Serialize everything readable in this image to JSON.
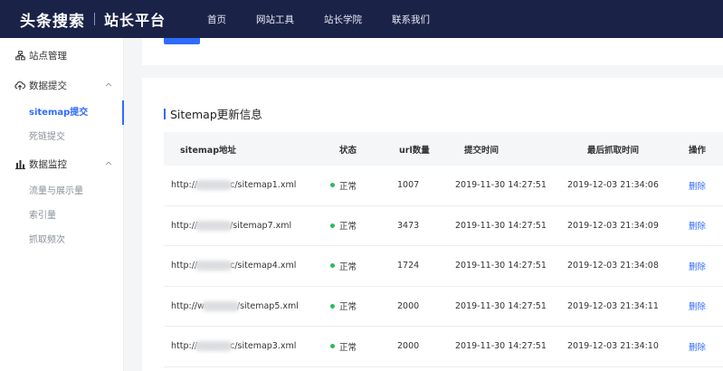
{
  "header": {
    "brand_main": "头条搜索",
    "brand_sub": "站长平台",
    "nav": [
      "首页",
      "网站工具",
      "站长学院",
      "联系我们"
    ]
  },
  "sidebar": {
    "groups": [
      {
        "label": "站点管理",
        "icon": "sitemap-icon",
        "items": []
      },
      {
        "label": "数据提交",
        "icon": "cloud-upload-icon",
        "items": [
          "sitemap提交",
          "死链提交"
        ],
        "active": "sitemap提交"
      },
      {
        "label": "数据监控",
        "icon": "bar-chart-icon",
        "items": [
          "流量与展示量",
          "索引量",
          "抓取频次"
        ]
      }
    ]
  },
  "section": {
    "title": "Sitemap更新信息"
  },
  "table": {
    "headers": [
      "sitemap地址",
      "状态",
      "url数量",
      "提交时间",
      "最后抓取时间",
      "操作"
    ],
    "rows": [
      {
        "url_prefix": "http://",
        "url_suffix": "c/sitemap1.xml",
        "status": "正常",
        "count": "1007",
        "submitted": "2019-11-30 14:27:51",
        "last_crawl": "2019-12-03 21:34:06",
        "action": "删除"
      },
      {
        "url_prefix": "http://",
        "url_suffix": "/sitemap7.xml",
        "status": "正常",
        "count": "3473",
        "submitted": "2019-11-30 14:27:51",
        "last_crawl": "2019-12-03 21:34:09",
        "action": "删除"
      },
      {
        "url_prefix": "http://",
        "url_suffix": "c/sitemap4.xml",
        "status": "正常",
        "count": "1724",
        "submitted": "2019-11-30 14:27:51",
        "last_crawl": "2019-12-03 21:34:08",
        "action": "删除"
      },
      {
        "url_prefix": "http://w",
        "url_suffix": "/sitemap5.xml",
        "status": "正常",
        "count": "2000",
        "submitted": "2019-11-30 14:27:51",
        "last_crawl": "2019-12-03 21:34:11",
        "action": "删除"
      },
      {
        "url_prefix": "http://",
        "url_suffix": "c/sitemap3.xml",
        "status": "正常",
        "count": "2000",
        "submitted": "2019-11-30 14:27:51",
        "last_crawl": "2019-12-03 21:34:10",
        "action": "删除"
      }
    ]
  },
  "colors": {
    "accent": "#2f6bff",
    "nav_bg": "#1a2247",
    "status_ok": "#2fb95c"
  }
}
